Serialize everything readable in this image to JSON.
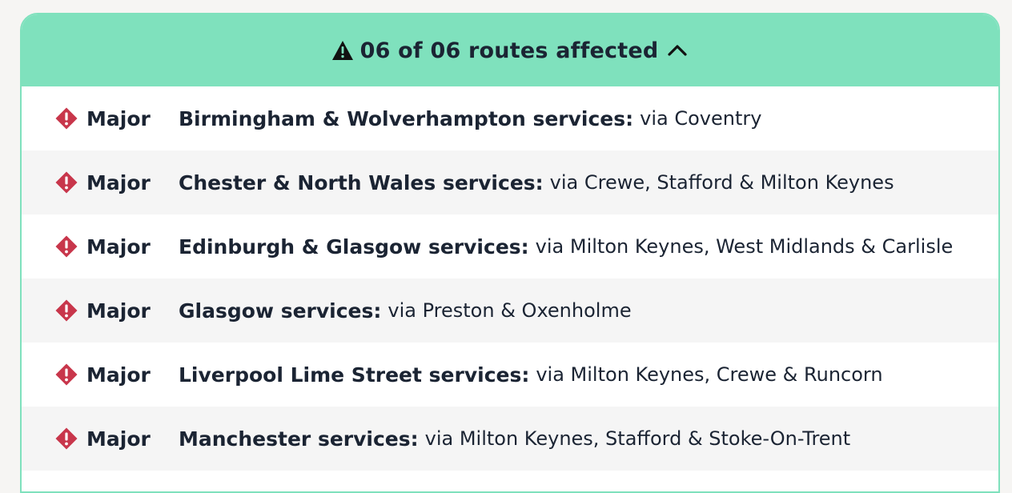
{
  "header": {
    "text": "06 of 06 routes affected",
    "warning_icon": "warning-triangle-icon",
    "toggle_icon": "chevron-up-icon",
    "background_color": "#7fe1bd"
  },
  "routes": [
    {
      "severity": "Major",
      "name": "Birmingham & Wolverhampton services:",
      "via": "via Coventry"
    },
    {
      "severity": "Major",
      "name": "Chester & North Wales services:",
      "via": "via Crewe, Stafford & Milton Keynes"
    },
    {
      "severity": "Major",
      "name": "Edinburgh & Glasgow services:",
      "via": "via Milton Keynes, West Midlands & Carlisle"
    },
    {
      "severity": "Major",
      "name": "Glasgow services:",
      "via": "via Preston & Oxenholme"
    },
    {
      "severity": "Major",
      "name": "Liverpool Lime Street services:",
      "via": "via Milton Keynes, Crewe & Runcorn"
    },
    {
      "severity": "Major",
      "name": "Manchester services:",
      "via": "via Milton Keynes, Stafford & Stoke-On-Trent"
    }
  ],
  "severity_icon": "major-disruption-icon",
  "severity_color": "#c8364b"
}
